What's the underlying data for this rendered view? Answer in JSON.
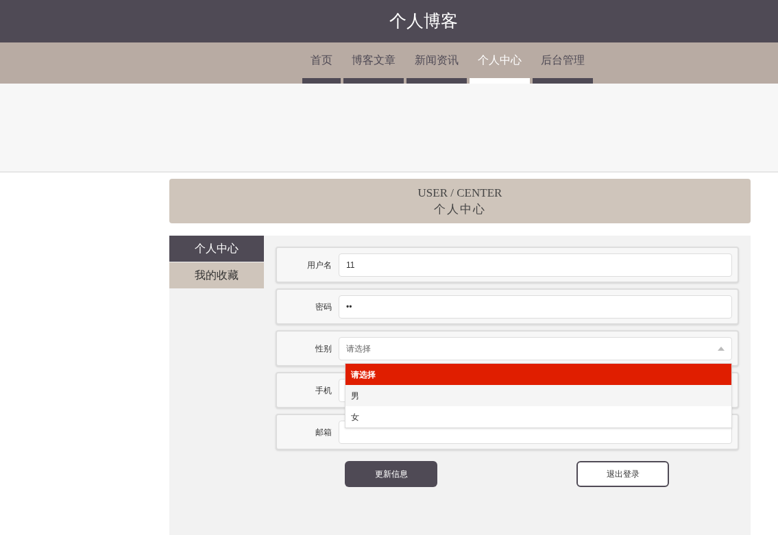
{
  "header": {
    "title": "个人博客"
  },
  "nav": [
    {
      "label": "首页",
      "selected": false
    },
    {
      "label": "博客文章",
      "selected": false
    },
    {
      "label": "新闻资讯",
      "selected": false
    },
    {
      "label": "个人中心",
      "selected": true
    },
    {
      "label": "后台管理",
      "selected": false
    }
  ],
  "section_heading": {
    "english": "USER / CENTER",
    "chinese": "个人中心"
  },
  "sidebar": [
    {
      "label": "个人中心",
      "selected": true
    },
    {
      "label": "我的收藏",
      "selected": false
    }
  ],
  "form": {
    "fields": [
      {
        "kind": "text",
        "label": "用户名",
        "value": "11"
      },
      {
        "kind": "text",
        "label": "密码",
        "value": "••"
      },
      {
        "kind": "select",
        "label": "性别",
        "placeholder": "请选择",
        "expanded": true,
        "options": [
          {
            "label": "请选择",
            "selected": true
          },
          {
            "label": "男",
            "selected": false
          },
          {
            "label": "女",
            "selected": false
          }
        ]
      },
      {
        "kind": "text",
        "label": "手机"
      },
      {
        "kind": "text",
        "label": "邮箱"
      }
    ],
    "buttons": [
      {
        "kind": "primary",
        "label": "更新信息"
      },
      {
        "kind": "outline",
        "label": "退出登录"
      }
    ]
  }
}
